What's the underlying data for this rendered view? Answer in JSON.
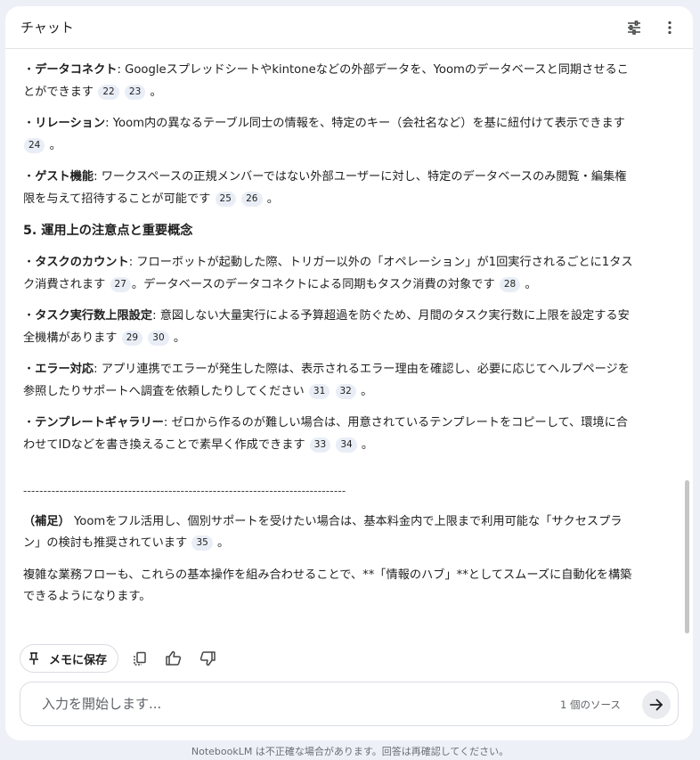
{
  "header": {
    "title": "チャット",
    "settings_icon": "tune-icon",
    "menu_icon": "more-vert-icon"
  },
  "content": {
    "bullets_top": [
      {
        "term": "データコネクト",
        "text": ": Googleスプレッドシートやkintoneなどの外部データを、Yoomのデータベースと同期させることができます",
        "cites": [
          "22",
          "23"
        ],
        "end": "。"
      },
      {
        "term": "リレーション",
        "text": ": Yoom内の異なるテーブル同士の情報を、特定のキー（会社名など）を基に紐付けて表示できます",
        "cites": [
          "24"
        ],
        "end": "。"
      },
      {
        "term": "ゲスト機能",
        "text": ": ワークスペースの正規メンバーではない外部ユーザーに対し、特定のデータベースのみ閲覧・編集権限を与えて招待することが可能です",
        "cites": [
          "25",
          "26"
        ],
        "end": "。"
      }
    ],
    "section_heading": "5. 運用上の注意点と重要概念",
    "bullets_bottom": [
      {
        "term": "タスクのカウント",
        "text": ": フローボットが起動した際、トリガー以外の「オペレーション」が1回実行されるごとに1タスク消費されます",
        "cites": [
          "27"
        ],
        "mid": "。データベースのデータコネクトによる同期もタスク消費の対象です",
        "cites2": [
          "28"
        ],
        "end": "。"
      },
      {
        "term": "タスク実行数上限設定",
        "text": ": 意図しない大量実行による予算超過を防ぐため、月間のタスク実行数に上限を設定する安全機構があります",
        "cites": [
          "29",
          "30"
        ],
        "end": "。"
      },
      {
        "term": "エラー対応",
        "text": ": アプリ連携でエラーが発生した際は、表示されるエラー理由を確認し、必要に応じてヘルプページを参照したりサポートへ調査を依頼したりしてください",
        "cites": [
          "31",
          "32"
        ],
        "end": "。"
      },
      {
        "term": "テンプレートギャラリー",
        "text": ": ゼロから作るのが難しい場合は、用意されているテンプレートをコピーして、環境に合わせてIDなどを書き換えることで素早く作成できます",
        "cites": [
          "33",
          "34"
        ],
        "end": "。"
      }
    ],
    "divider": "--------------------------------------------------------------------------------",
    "note_label": "（補足）",
    "note_text": " Yoomをフル活用し、個別サポートを受けたい場合は、基本料金内で上限まで利用可能な「サクセスプラン」の検討も推奨されています",
    "note_cite": "35",
    "note_end": "。",
    "closing": "複雑な業務フローも、これらの基本操作を組み合わせることで、**「情報のハブ」**としてスムーズに自動化を構築できるようになります。"
  },
  "actions": {
    "save_memo_label": "メモに保存",
    "pin_icon": "pin-icon",
    "copy_icon": "copy-icon",
    "thumbs_up_icon": "thumbs-up-icon",
    "thumbs_down_icon": "thumbs-down-icon"
  },
  "input": {
    "placeholder": "入力を開始します...",
    "value": "",
    "source_count": "1 個のソース",
    "send_icon": "arrow-right-icon"
  },
  "footer": {
    "disclaimer": "NotebookLM は不正確な場合があります。回答は再確認してください。"
  }
}
